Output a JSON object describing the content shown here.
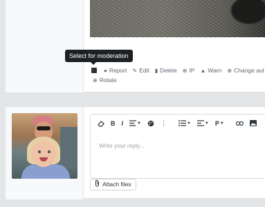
{
  "post": {
    "tooltip": "Select for moderation",
    "actions": [
      {
        "icon": "report-icon",
        "glyph": "●",
        "label": "Report"
      },
      {
        "icon": "edit-icon",
        "glyph": "✎",
        "label": "Edit"
      },
      {
        "icon": "delete-icon",
        "glyph": "▮",
        "label": "Delete"
      },
      {
        "icon": "ip-icon",
        "glyph": "⊕",
        "label": "IP"
      },
      {
        "icon": "warn-icon",
        "glyph": "▲",
        "label": "Warn"
      },
      {
        "icon": "change-author-icon",
        "glyph": "⊕",
        "label": "Change aut"
      }
    ],
    "rotate": {
      "icon": "rotate-icon",
      "glyph": "⊕",
      "label": "Rotate"
    }
  },
  "reply": {
    "placeholder": "Write your reply...",
    "attach_label": "Attach files",
    "toolbar": [
      "eraser-icon",
      "bold-icon",
      "italic-icon",
      "align-icon",
      "palette-icon",
      "more-icon",
      "list-icon",
      "paragraph-align-icon",
      "paragraph-icon",
      "link-icon",
      "image-icon"
    ]
  }
}
